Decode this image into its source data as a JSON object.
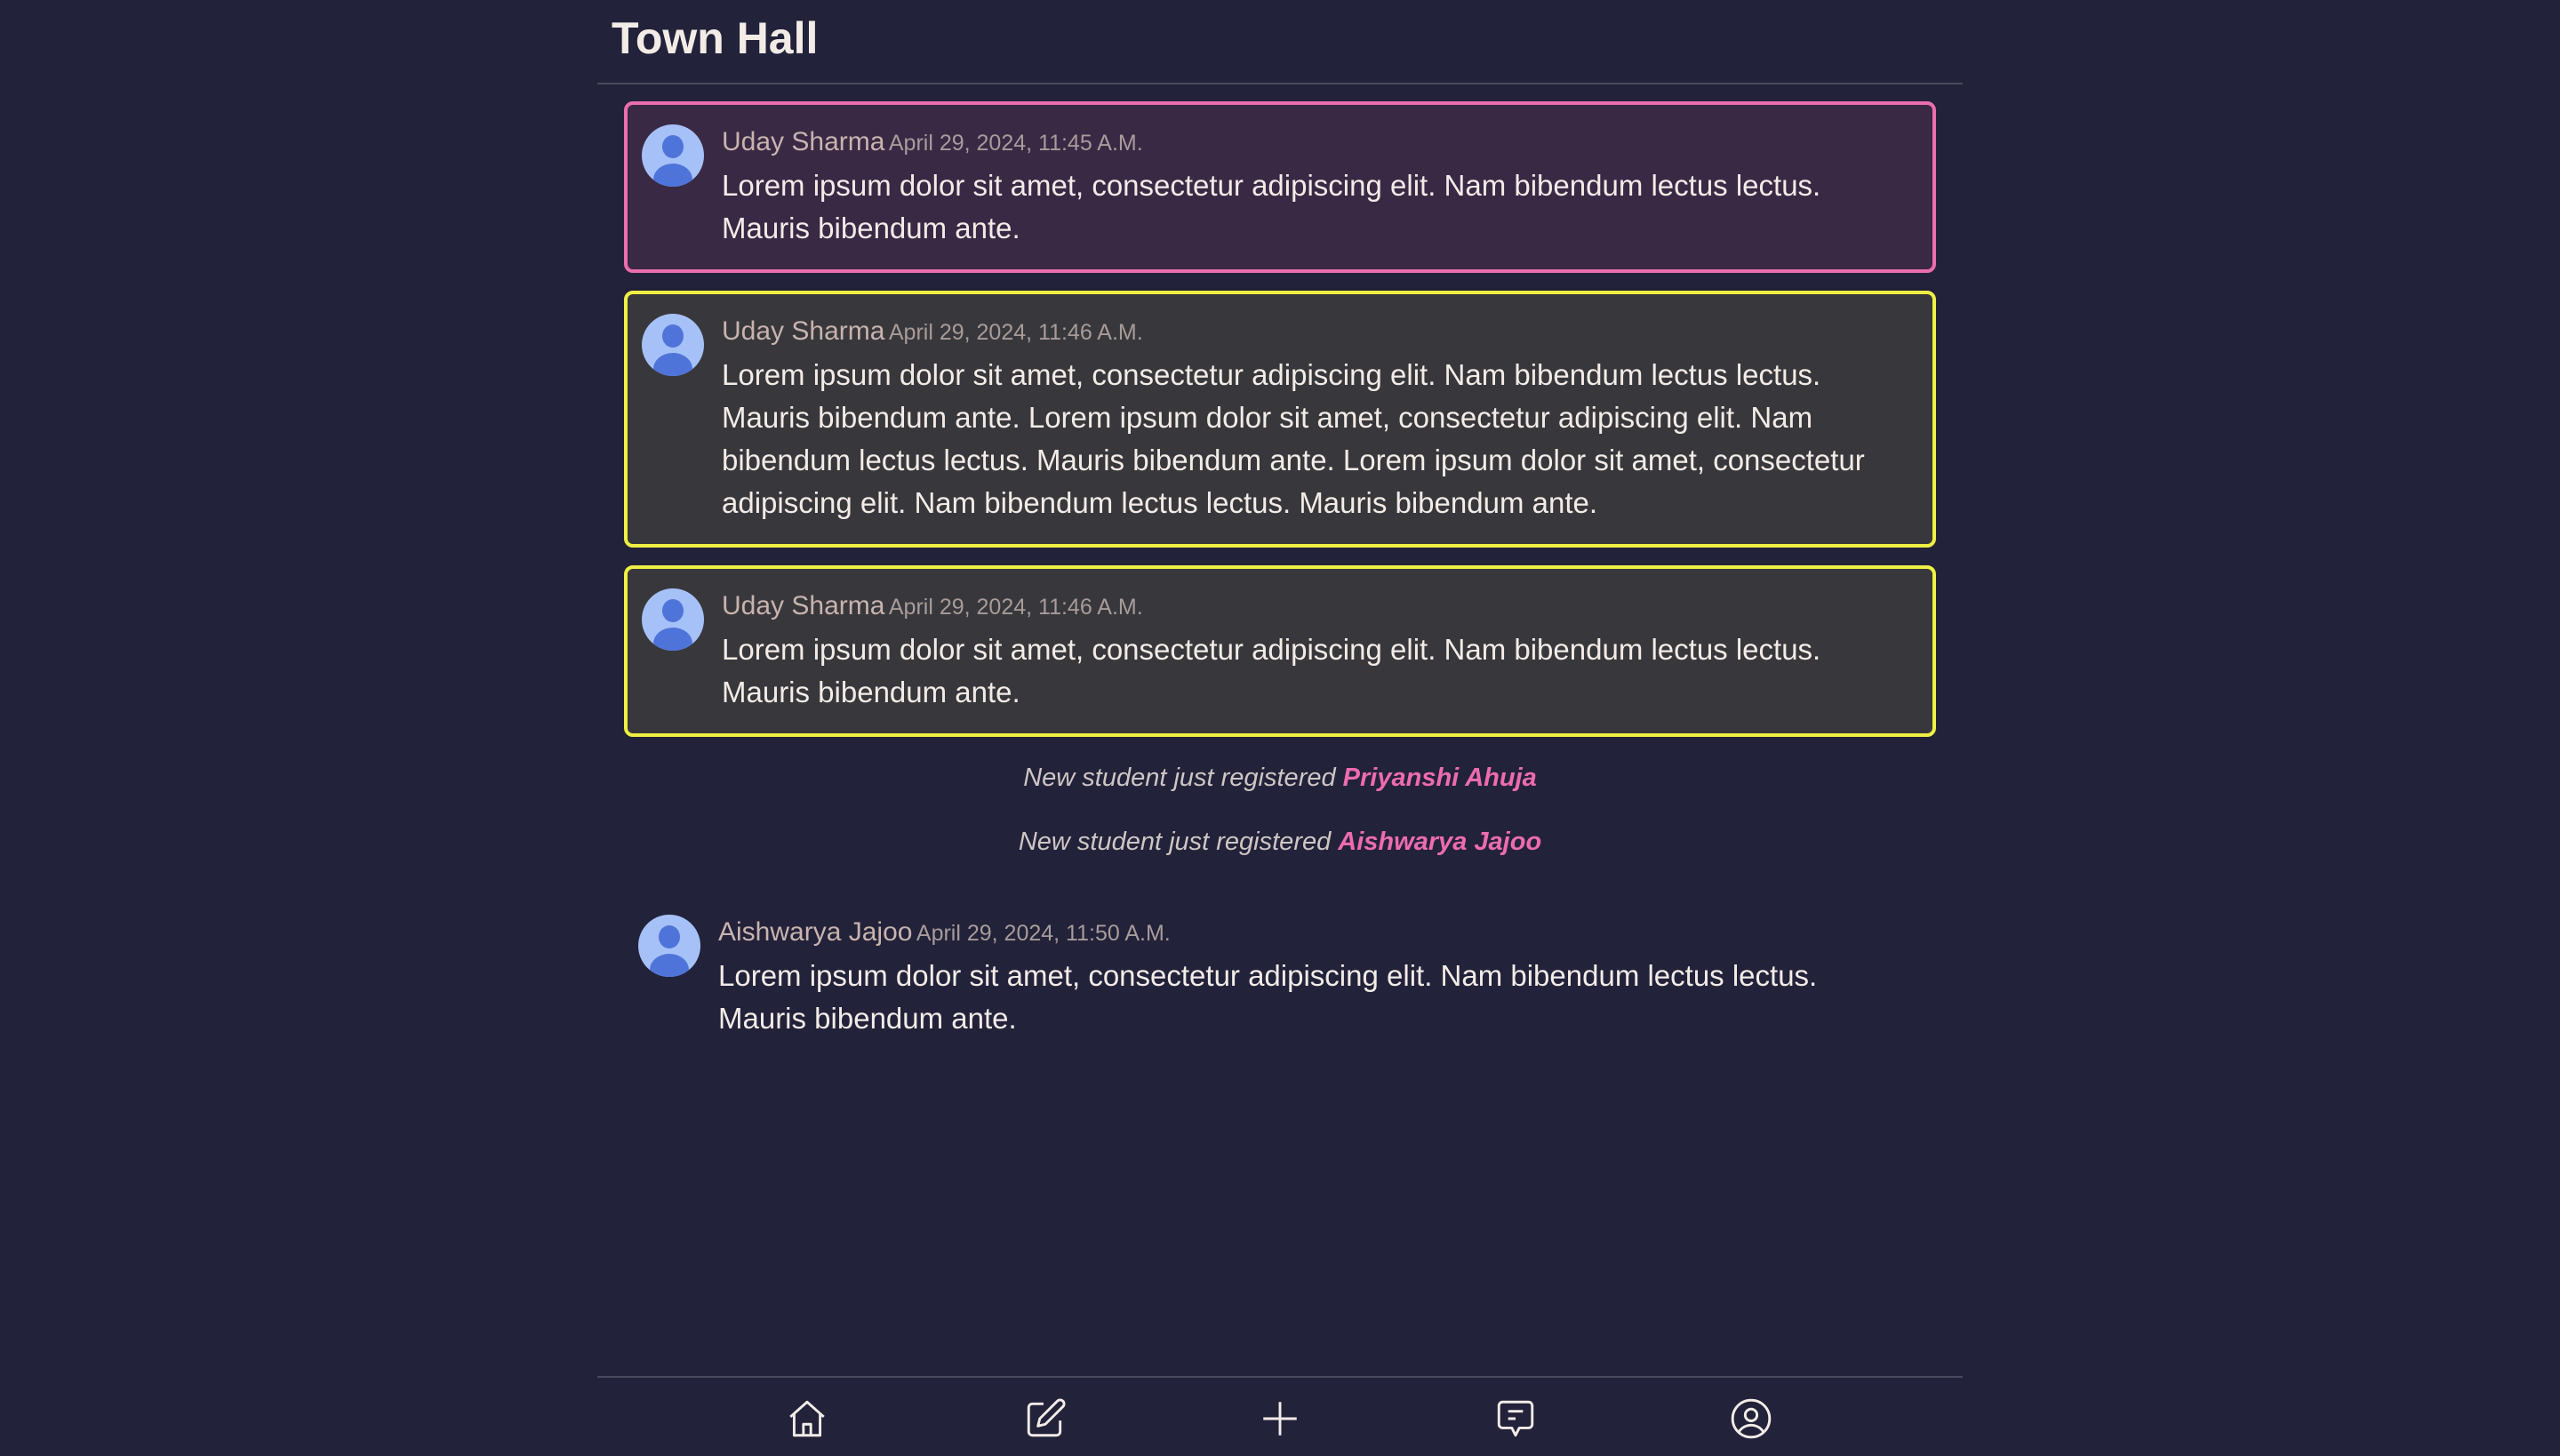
{
  "header": {
    "title": "Town Hall"
  },
  "colors": {
    "background": "#22223a",
    "highlight_pink": "#ec6db0",
    "highlight_yellow": "#eef043",
    "avatar": "#a6c1f7"
  },
  "messages": [
    {
      "author": "Uday Sharma",
      "time": "April 29, 2024, 11:45 A.M.",
      "text": "Lorem ipsum dolor sit amet, consectetur adipiscing elit. Nam bibendum lectus lectus. Mauris bibendum ante.",
      "style": "pink"
    },
    {
      "author": "Uday Sharma",
      "time": "April 29, 2024, 11:46 A.M.",
      "text": "Lorem ipsum dolor sit amet, consectetur adipiscing elit. Nam bibendum lectus lectus. Mauris bibendum ante. Lorem ipsum dolor sit amet, consectetur adipiscing elit. Nam bibendum lectus lectus. Mauris bibendum ante. Lorem ipsum dolor sit amet, consectetur adipiscing elit. Nam bibendum lectus lectus. Mauris bibendum ante.",
      "style": "yellow"
    },
    {
      "author": "Uday Sharma",
      "time": "April 29, 2024, 11:46 A.M.",
      "text": "Lorem ipsum dolor sit amet, consectetur adipiscing elit. Nam bibendum lectus lectus. Mauris bibendum ante.",
      "style": "yellow"
    }
  ],
  "system": [
    {
      "prefix": "New student just registered",
      "name": "Priyanshi Ahuja"
    },
    {
      "prefix": "New student just registered",
      "name": "Aishwarya Jajoo"
    }
  ],
  "last_message": {
    "author": "Aishwarya Jajoo",
    "time": "April 29, 2024, 11:50 A.M.",
    "text": "Lorem ipsum dolor sit amet, consectetur adipiscing elit. Nam bibendum lectus lectus. Mauris bibendum ante."
  },
  "nav": [
    {
      "icon": "home-icon"
    },
    {
      "icon": "edit-icon"
    },
    {
      "icon": "plus-icon"
    },
    {
      "icon": "chat-icon"
    },
    {
      "icon": "user-circle-icon"
    }
  ]
}
